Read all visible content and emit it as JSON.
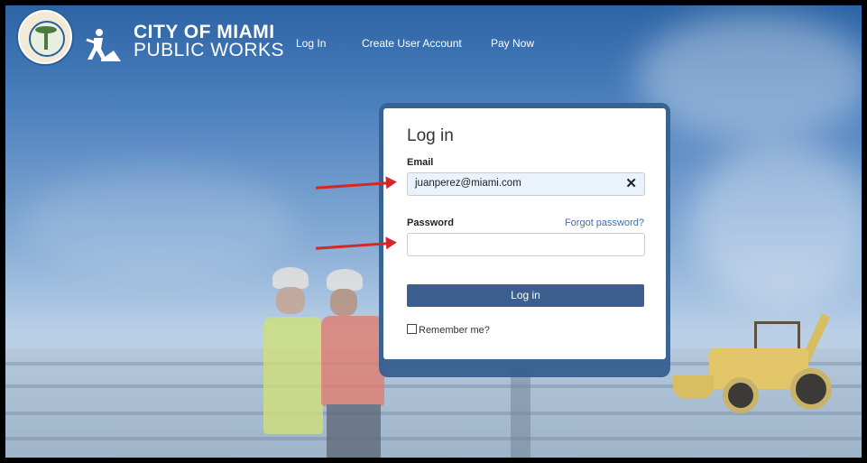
{
  "header": {
    "brand_line1": "CITY OF MIAMI",
    "brand_line2": "PUBLIC WORKS",
    "seal_text": "THE CITY OF MIAMI · DADE CO. FLORIDA",
    "nav": [
      {
        "label": "Log In"
      },
      {
        "label": "Create User Account"
      },
      {
        "label": "Pay Now"
      }
    ]
  },
  "login": {
    "title": "Log in",
    "email_label": "Email",
    "email_value": "juanperez@miami.com",
    "clear_icon": "close-icon",
    "password_label": "Password",
    "password_value": "",
    "forgot_label": "Forgot password?",
    "submit_label": "Log in",
    "remember_label": "Remember me?"
  },
  "annotations": {
    "arrow_color": "#d42828"
  },
  "colors": {
    "button": "#3c5f8f",
    "link": "#3b6fb5",
    "card_border": "#36608f"
  }
}
